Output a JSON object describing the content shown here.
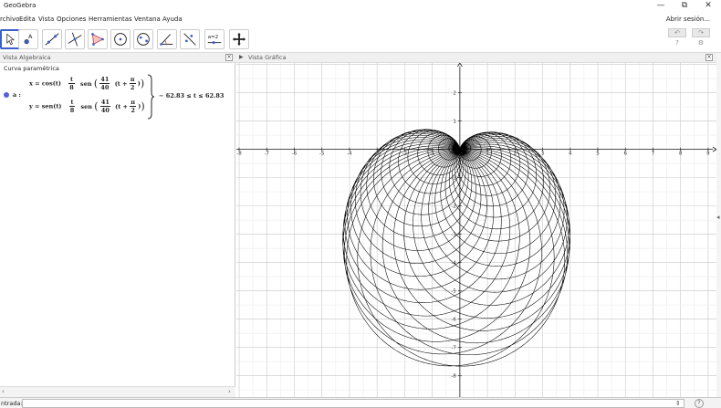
{
  "window": {
    "title": "GeoGebra",
    "minimize": "—",
    "restore": "⧉",
    "close": "✕"
  },
  "menu": {
    "items": [
      "rchivo",
      "Edita",
      "Vista",
      "Opciones",
      "Herramientas",
      "Ventana",
      "Ayuda"
    ],
    "signin": "Abrir sesión..."
  },
  "toolbar": {
    "tools": [
      "move-tool-icon",
      "point-tool-icon",
      "line-tool-icon",
      "perpendicular-tool-icon",
      "polygon-tool-icon",
      "circle-tool-icon",
      "ellipse-tool-icon",
      "angle-tool-icon",
      "reflect-tool-icon",
      "slider-tool-icon",
      "move-view-tool-icon"
    ],
    "slider_label": "a=2",
    "undo": "↶",
    "redo": "↷",
    "help": "?",
    "settings": "⚙"
  },
  "algebra": {
    "header": "Vista Algebraica",
    "category": "Curva paramétrica",
    "object_name": "a :",
    "x_prefix": "x = cos(t)",
    "y_prefix": "y = sen(t)",
    "t_num": "t",
    "t_den": "8",
    "func": "sen",
    "k_num": "41",
    "k_den": "40",
    "phase_t": "(t +",
    "pi_num": "π",
    "pi_den": "2",
    "range": "− 62.83 ≤ t ≤ 62.83"
  },
  "graphics": {
    "header": "Vista Gráfica",
    "header_arrow": "▶"
  },
  "input_bar": {
    "label": "ntrada:",
    "help": "?",
    "toggle": "⇕"
  },
  "chart_data": {
    "type": "line",
    "x_ticks": [
      "-8",
      "-7",
      "-6",
      "-5",
      "-4",
      "-3",
      "-2",
      "-1",
      "1",
      "2",
      "3",
      "4",
      "5",
      "6",
      "7",
      "8",
      "9"
    ],
    "y_ticks": [
      "2",
      "1",
      "-1",
      "-2",
      "-3",
      "-4",
      "-5",
      "-6",
      "-7",
      "-8"
    ],
    "xlim": [
      -8.1,
      9.3
    ],
    "ylim": [
      -8.75,
      3.05
    ],
    "grid": true,
    "curve": {
      "x": "cos(t)*(t/8)*sin((41/40)*(t+pi/2))",
      "y": "sin(t)*(t/8)*sin((41/40)*(t+pi/2))",
      "t_range": [
        -62.83,
        62.83
      ]
    }
  }
}
